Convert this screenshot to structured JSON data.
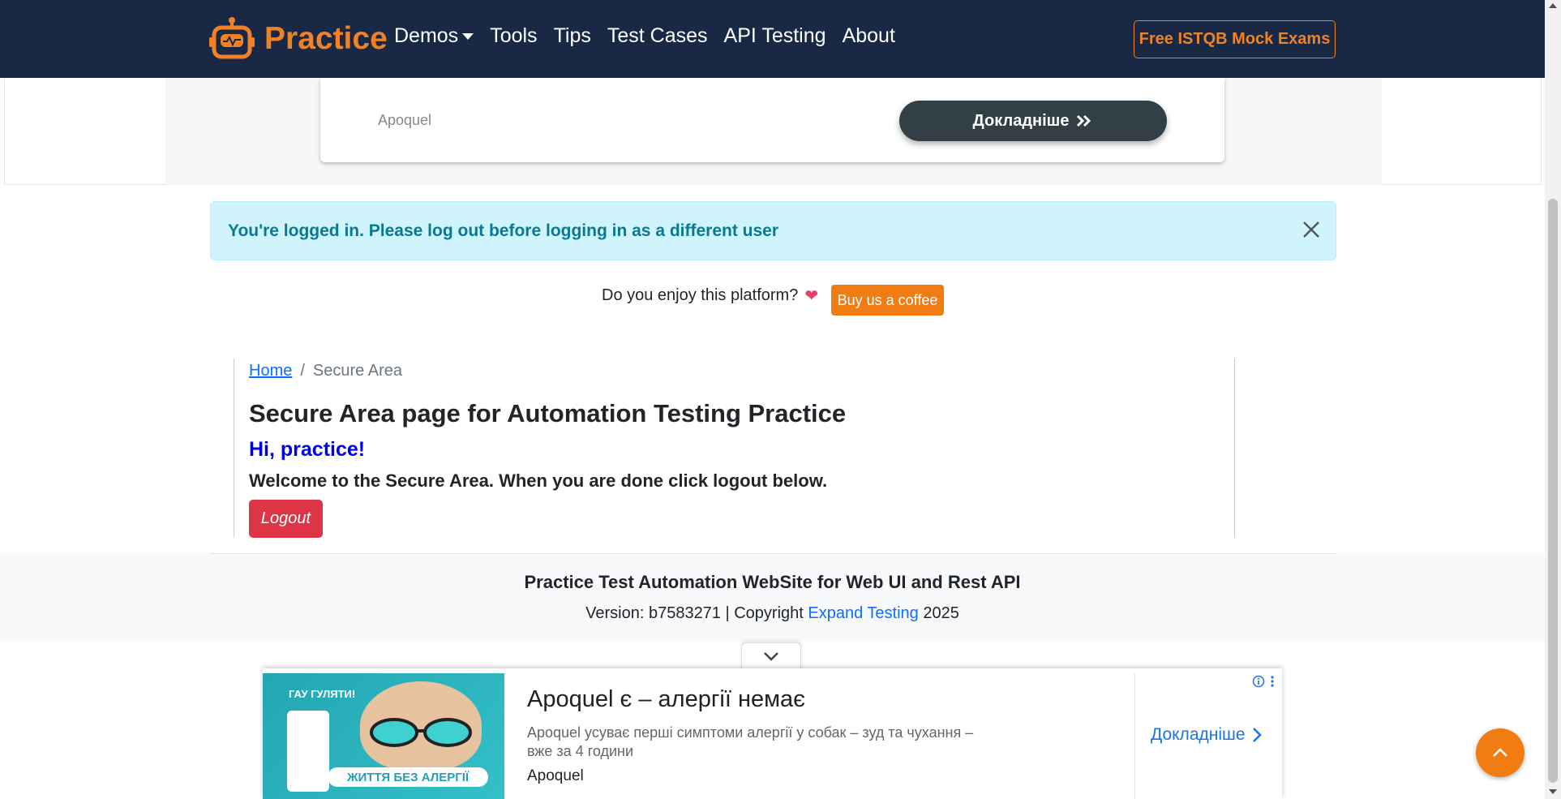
{
  "header": {
    "brand": "Practice",
    "nav": [
      "Demos",
      "Tools",
      "Tips",
      "Test Cases",
      "API Testing",
      "About"
    ],
    "cta": "Free ISTQB Mock Exams"
  },
  "top_ad": {
    "label": "Apoquel",
    "button": "Докладніше"
  },
  "alert": {
    "text": "You're logged in. Please log out before logging in as a different user"
  },
  "support": {
    "text": "Do you enjoy this platform?",
    "button": "Buy us a coffee"
  },
  "breadcrumb": {
    "home": "Home",
    "separator": "/",
    "current": "Secure Area"
  },
  "main": {
    "title": "Secure Area page for Automation Testing Practice",
    "greeting": "Hi, practice!",
    "welcome": "Welcome to the Secure Area. When you are done click logout below.",
    "logout": "Logout"
  },
  "footer": {
    "title": "Practice Test Automation WebSite for Web UI and Rest API",
    "version_prefix": "Version: b7583271 | Copyright",
    "link": "Expand Testing",
    "year": "2025"
  },
  "bottom_ad": {
    "image_top_text": "ГАУ ГУЛЯТИ!",
    "image_band_text": "ЖИТТЯ БЕЗ АЛЕРГІЇ",
    "headline": "Apoquel є – алергії немає",
    "description": "Apoquel усуває перші симптоми алергії у собак – зуд та чухання – вже за 4 години",
    "brand": "Apoquel",
    "link": "Докладніше"
  },
  "colors": {
    "navbar": "#182845",
    "accent": "#f08124",
    "alert_bg": "#cff4fc",
    "logout": "#dc3545"
  }
}
